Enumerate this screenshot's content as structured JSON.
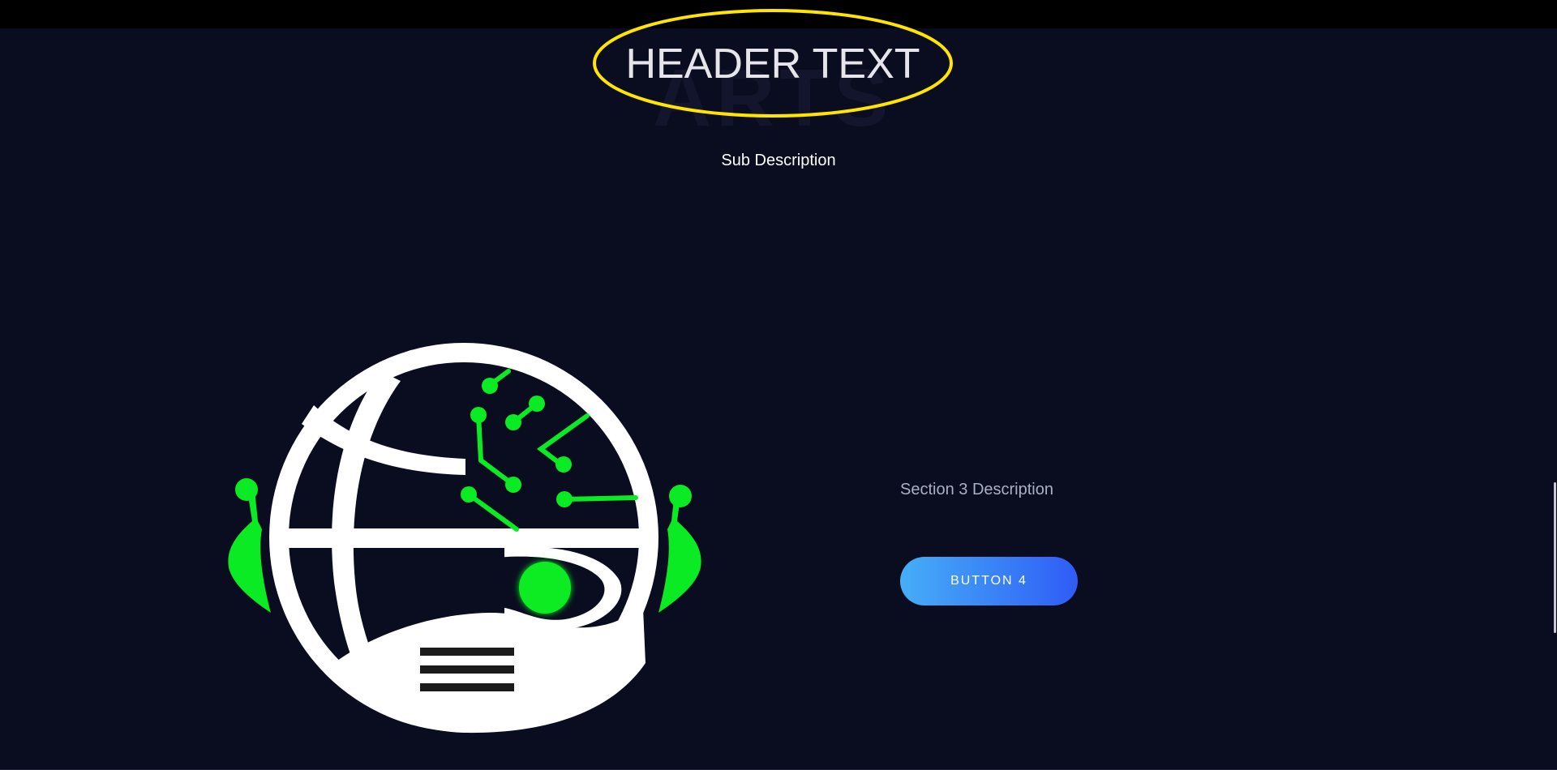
{
  "header": {
    "title": "HEADER TEXT",
    "ghost_text": "ARTS"
  },
  "hero": {
    "sub_description": "Sub Description"
  },
  "section3": {
    "description": "Section 3 Description",
    "button_label": "BUTTON 4"
  },
  "colors": {
    "background": "#0a0c1f",
    "topbar": "#000000",
    "ellipse_outline": "#ffe500",
    "robot_body": "#ffffff",
    "robot_accent": "#0aeb23",
    "button_gradient_start": "#46aef7",
    "button_gradient_end": "#2f5cf5"
  },
  "icons": {
    "logo": "robot-globe-logo-icon"
  }
}
